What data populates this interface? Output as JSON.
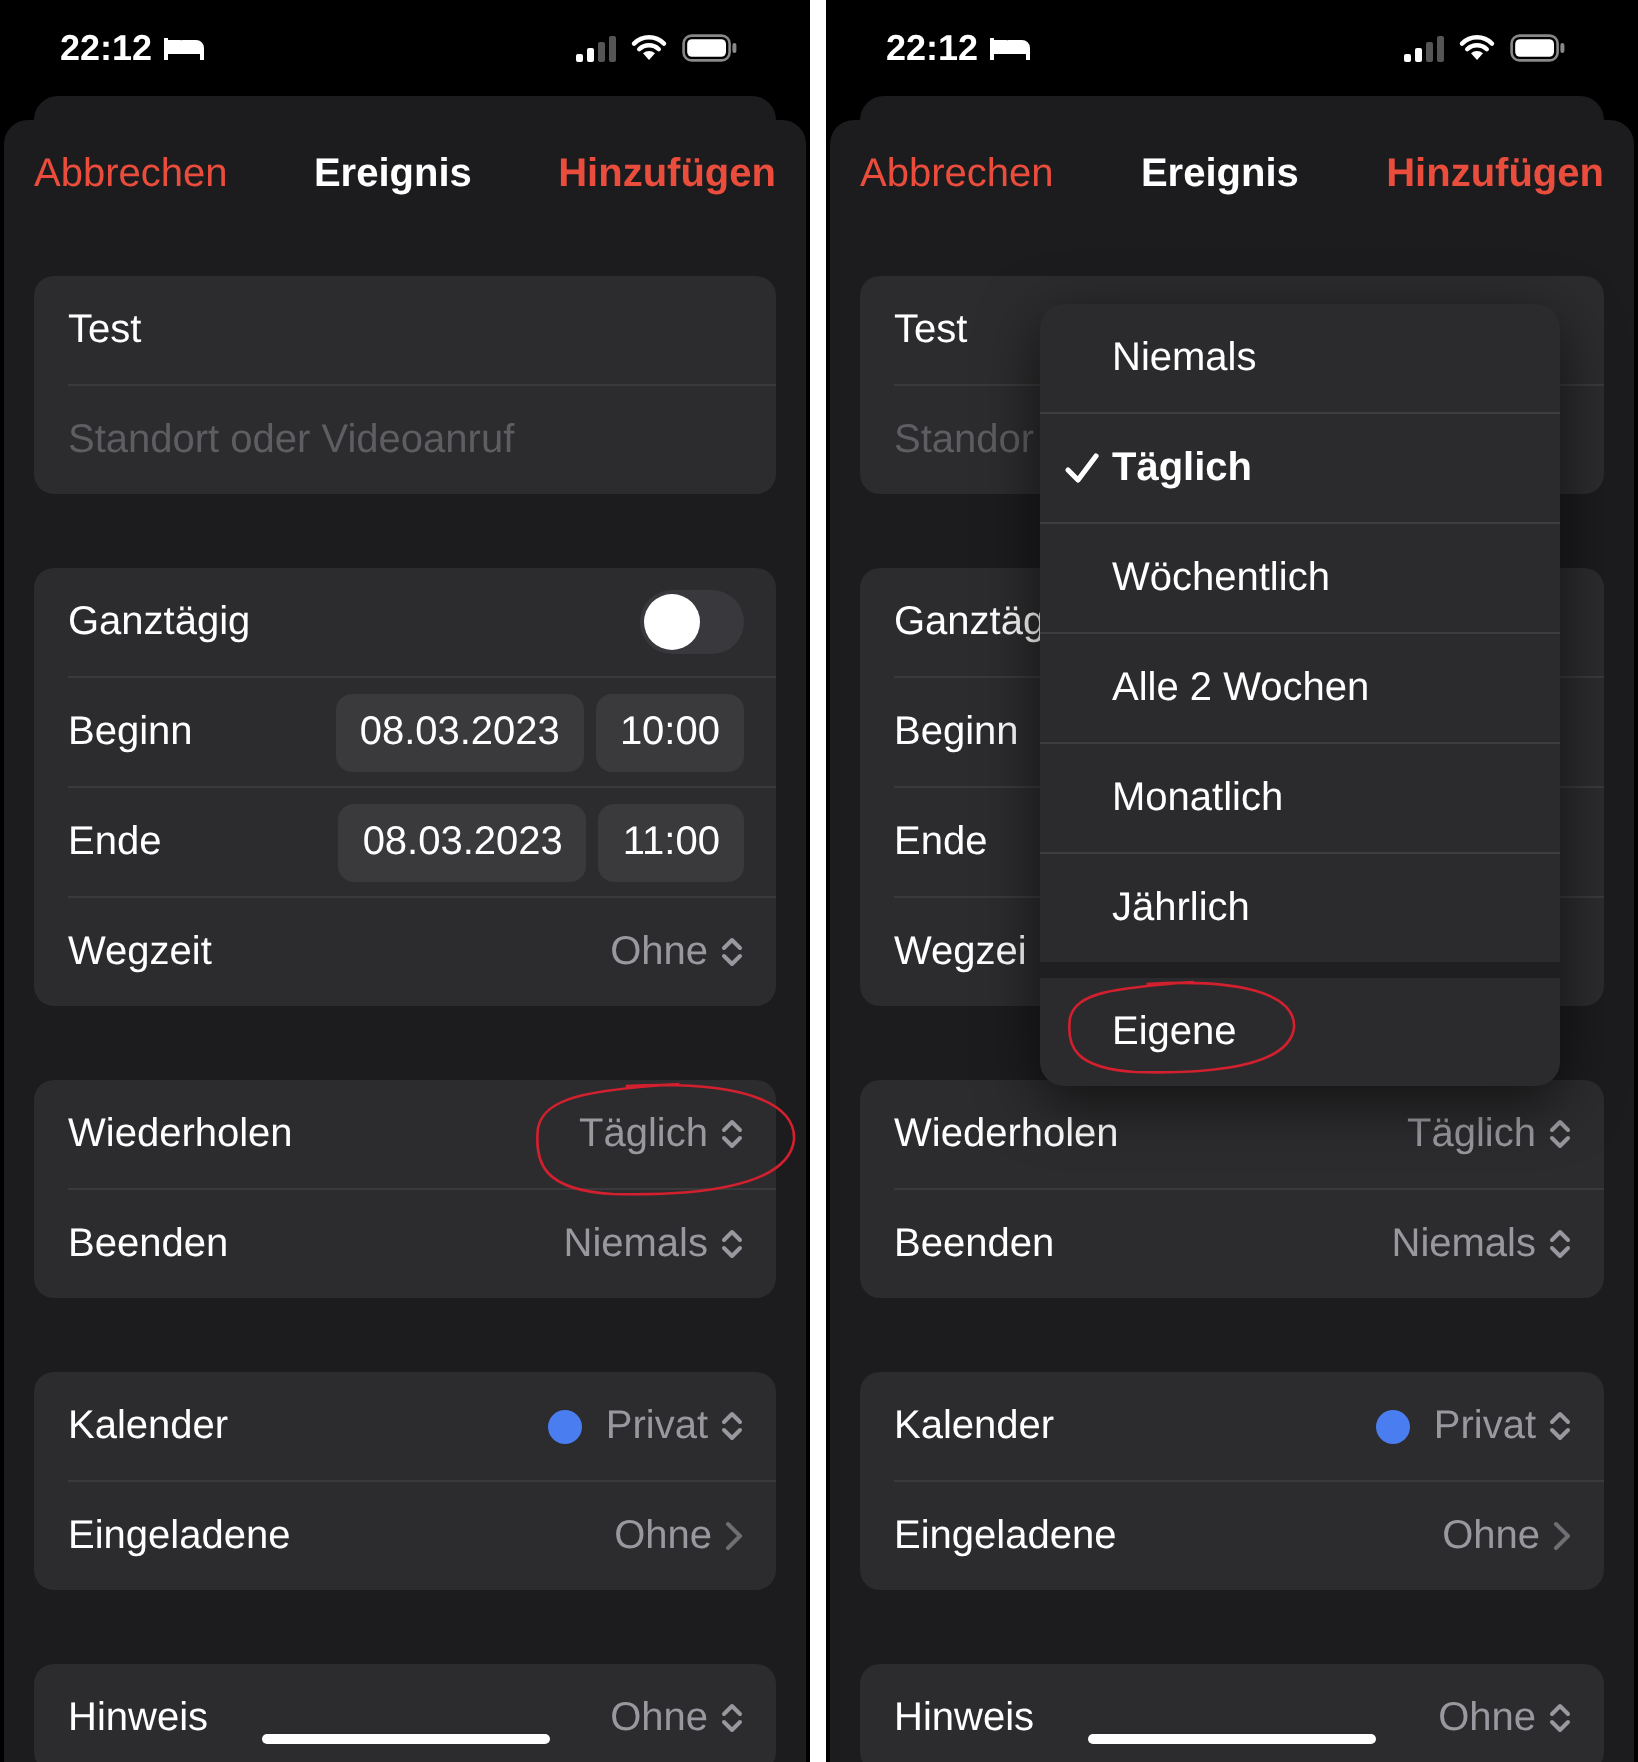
{
  "screens": [
    {
      "status": {
        "time": "22:12"
      },
      "nav": {
        "cancel": "Abbrechen",
        "title": "Ereignis",
        "add": "Hinzufügen"
      },
      "groups": [
        {
          "rows": [
            {
              "kind": "text",
              "label": "Test"
            },
            {
              "kind": "field",
              "placeholder": "Standort oder Videoanruf"
            }
          ]
        },
        {
          "rows": [
            {
              "kind": "toggle",
              "label": "Ganztägig",
              "on": false
            },
            {
              "kind": "datetime",
              "label": "Beginn",
              "date": "08.03.2023",
              "time": "10:00"
            },
            {
              "kind": "datetime",
              "label": "Ende",
              "date": "08.03.2023",
              "time": "11:00"
            },
            {
              "kind": "picker",
              "label": "Wegzeit",
              "value": "Ohne",
              "circled": false
            }
          ]
        },
        {
          "rows": [
            {
              "kind": "picker",
              "label": "Wiederholen",
              "value": "Täglich",
              "circled": true
            },
            {
              "kind": "picker",
              "label": "Beenden",
              "value": "Niemals",
              "circled": false
            }
          ]
        },
        {
          "rows": [
            {
              "kind": "calendar",
              "label": "Kalender",
              "value": "Privat",
              "color": "#4a7ef0"
            },
            {
              "kind": "link",
              "label": "Eingeladene",
              "value": "Ohne"
            }
          ]
        },
        {
          "rows": [
            {
              "kind": "picker",
              "label": "Hinweis",
              "value": "Ohne",
              "circled": false
            }
          ]
        }
      ]
    },
    {
      "status": {
        "time": "22:12"
      },
      "nav": {
        "cancel": "Abbrechen",
        "title": "Ereignis",
        "add": "Hinzufügen"
      },
      "groups": [
        {
          "rows": [
            {
              "kind": "text",
              "label": "Test"
            },
            {
              "kind": "field",
              "placeholder": "Standor"
            }
          ]
        },
        {
          "rows": [
            {
              "kind": "toggle",
              "label": "Ganztäg"
            },
            {
              "kind": "datetime",
              "label": "Beginn"
            },
            {
              "kind": "datetime",
              "label": "Ende"
            },
            {
              "kind": "picker",
              "label": "Wegzei"
            }
          ]
        },
        {
          "rows": [
            {
              "kind": "picker",
              "label": "Wiederholen",
              "value": "Täglich",
              "circled": false
            },
            {
              "kind": "picker",
              "label": "Beenden",
              "value": "Niemals",
              "circled": false
            }
          ]
        },
        {
          "rows": [
            {
              "kind": "calendar",
              "label": "Kalender",
              "value": "Privat",
              "color": "#4a7ef0"
            },
            {
              "kind": "link",
              "label": "Eingeladene",
              "value": "Ohne"
            }
          ]
        },
        {
          "rows": [
            {
              "kind": "picker",
              "label": "Hinweis",
              "value": "Ohne",
              "circled": false
            }
          ]
        }
      ],
      "menu": {
        "items": [
          {
            "label": "Niemals",
            "selected": false,
            "circled": false
          },
          {
            "label": "Täglich",
            "selected": true,
            "circled": false
          },
          {
            "label": "Wöchentlich",
            "selected": false,
            "circled": false
          },
          {
            "label": "Alle 2 Wochen",
            "selected": false,
            "circled": false
          },
          {
            "label": "Monatlich",
            "selected": false,
            "circled": false
          },
          {
            "label": "Jährlich",
            "selected": false,
            "circled": false
          },
          {
            "label": "Eigene",
            "selected": false,
            "circled": true
          }
        ]
      }
    }
  ]
}
